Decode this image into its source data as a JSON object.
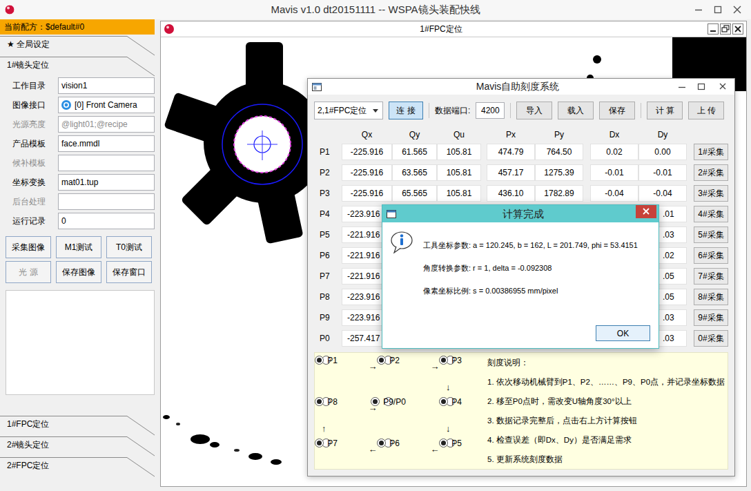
{
  "window": {
    "title": "Mavis v1.0 dt20151111 -- WSPA镜头装配快线"
  },
  "sidebar": {
    "recipe": "当前配方：$default#0",
    "sections": [
      {
        "label": "★ 全局设定",
        "expanded": false
      },
      {
        "label": "1#镜头定位",
        "expanded": true
      },
      {
        "label": "1#FPC定位",
        "expanded": false
      },
      {
        "label": "2#镜头定位",
        "expanded": false
      },
      {
        "label": "2#FPC定位",
        "expanded": false
      }
    ],
    "fields": [
      {
        "label": "工作目录",
        "value": "vision1",
        "disabled": false,
        "kind": "text"
      },
      {
        "label": "图像接口",
        "value": "[0] Front Camera",
        "disabled": false,
        "kind": "camera"
      },
      {
        "label": "光源亮度",
        "value": "@light01;@recipe",
        "disabled": true,
        "kind": "text"
      },
      {
        "label": "产品模板",
        "value": "face.mmdl",
        "disabled": false,
        "kind": "text"
      },
      {
        "label": "候补模板",
        "value": "",
        "disabled": true,
        "kind": "text"
      },
      {
        "label": "坐标变换",
        "value": "mat01.tup",
        "disabled": false,
        "kind": "text"
      },
      {
        "label": "后台处理",
        "value": "",
        "disabled": true,
        "kind": "text"
      },
      {
        "label": "运行记录",
        "value": "0",
        "disabled": false,
        "kind": "text"
      }
    ],
    "buttons": [
      {
        "label": "采集图像",
        "disabled": false
      },
      {
        "label": "M1测试",
        "disabled": false
      },
      {
        "label": "T0测试",
        "disabled": false
      },
      {
        "label": "光 源",
        "disabled": true
      },
      {
        "label": "保存图像",
        "disabled": false
      },
      {
        "label": "保存窗口",
        "disabled": false
      }
    ]
  },
  "child_window": {
    "title": "1#FPC定位"
  },
  "calibration": {
    "title": "Mavis自助刻度系统",
    "target": "2,1#FPC定位",
    "connect": {
      "label": "连 接",
      "pressed": true
    },
    "port_label": "数据端口:",
    "port": "4200",
    "file_buttons": [
      "导入",
      "载入",
      "保存"
    ],
    "action_buttons": [
      "计 算",
      "上 传"
    ],
    "columns": [
      "Qx",
      "Qy",
      "Qu",
      "Px",
      "Py",
      "Dx",
      "Dy"
    ],
    "rows": [
      {
        "name": "P1",
        "qx": "-225.916",
        "qy": "61.565",
        "qu": "105.81",
        "px": "474.79",
        "py": "764.50",
        "dx": "0.02",
        "dy": "0.00",
        "button": "1#采集"
      },
      {
        "name": "P2",
        "qx": "-225.916",
        "qy": "63.565",
        "qu": "105.81",
        "px": "457.17",
        "py": "1275.39",
        "dx": "-0.01",
        "dy": "-0.01",
        "button": "2#采集"
      },
      {
        "name": "P3",
        "qx": "-225.916",
        "qy": "65.565",
        "qu": "105.81",
        "px": "436.10",
        "py": "1782.89",
        "dx": "-0.04",
        "dy": "-0.04",
        "button": "3#采集"
      },
      {
        "name": "P4",
        "qx": "-223.916",
        "qy": "",
        "qu": "",
        "px": "",
        "py": "",
        "dx": "",
        "dy": ".01",
        "button": "4#采集"
      },
      {
        "name": "P5",
        "qx": "-221.916",
        "qy": "",
        "qu": "",
        "px": "",
        "py": "",
        "dx": "",
        "dy": ".03",
        "button": "5#采集"
      },
      {
        "name": "P6",
        "qx": "-221.916",
        "qy": "",
        "qu": "",
        "px": "",
        "py": "",
        "dx": "",
        "dy": ".02",
        "button": "6#采集"
      },
      {
        "name": "P7",
        "qx": "-221.916",
        "qy": "",
        "qu": "",
        "px": "",
        "py": "",
        "dx": "",
        "dy": ".05",
        "button": "7#采集"
      },
      {
        "name": "P8",
        "qx": "-223.916",
        "qy": "",
        "qu": "",
        "px": "",
        "py": "",
        "dx": "",
        "dy": ".05",
        "button": "8#采集"
      },
      {
        "name": "P9",
        "qx": "-223.916",
        "qy": "",
        "qu": "",
        "px": "",
        "py": "",
        "dx": "",
        "dy": ".03",
        "button": "9#采集"
      },
      {
        "name": "P0",
        "qx": "-257.417",
        "qy": "",
        "qu": "",
        "px": "",
        "py": "",
        "dx": "",
        "dy": ".03",
        "button": "0#采集"
      }
    ],
    "diagram": [
      [
        {
          "kind": "radio",
          "label": "P1",
          "checked": true
        },
        {
          "kind": "arrow",
          "label": "→"
        },
        {
          "kind": "radio",
          "label": "P2",
          "checked": true
        },
        {
          "kind": "arrow",
          "label": "→"
        },
        {
          "kind": "radio",
          "label": "P3",
          "checked": true
        }
      ],
      [
        {
          "kind": "empty"
        },
        {
          "kind": "empty"
        },
        {
          "kind": "empty"
        },
        {
          "kind": "empty"
        },
        {
          "kind": "arrow",
          "label": "↓"
        }
      ],
      [
        {
          "kind": "radio",
          "label": "P8",
          "checked": true
        },
        {
          "kind": "arrow",
          "label": "→"
        },
        {
          "kind": "radio",
          "label": "P9/P0",
          "checked": true
        },
        {
          "kind": "empty"
        },
        {
          "kind": "radio",
          "label": "P4",
          "checked": true
        }
      ],
      [
        {
          "kind": "arrow",
          "label": "↑"
        },
        {
          "kind": "empty"
        },
        {
          "kind": "empty"
        },
        {
          "kind": "empty"
        },
        {
          "kind": "arrow",
          "label": "↓"
        }
      ],
      [
        {
          "kind": "radio",
          "label": "P7",
          "checked": true
        },
        {
          "kind": "arrow",
          "label": "←"
        },
        {
          "kind": "radio",
          "label": "P6",
          "checked": true
        },
        {
          "kind": "arrow",
          "label": "←"
        },
        {
          "kind": "radio",
          "label": "P5",
          "checked": true
        }
      ]
    ],
    "notes_title": "刻度说明：",
    "notes": [
      "1. 依次移动机械臂到P1、P2、……、P9、P0点，并记录坐标数据",
      "2. 移至P0点时，需改变U轴角度30°以上",
      "3. 数据记录完整后，点击右上方计算按钮",
      "4. 检查误差（即Dx、Dy）是否满足需求",
      "5. 更新系统刻度数据"
    ]
  },
  "dialog": {
    "title": "计算完成",
    "lines": [
      "工具坐标参数: a = 120.245, b = 162, L = 201.749, phi = 53.4151",
      "角度转换参数: r = 1, delta = -0.092308",
      "像素坐标比例: s = 0.00386955 mm/pixel"
    ],
    "button": "OK"
  }
}
